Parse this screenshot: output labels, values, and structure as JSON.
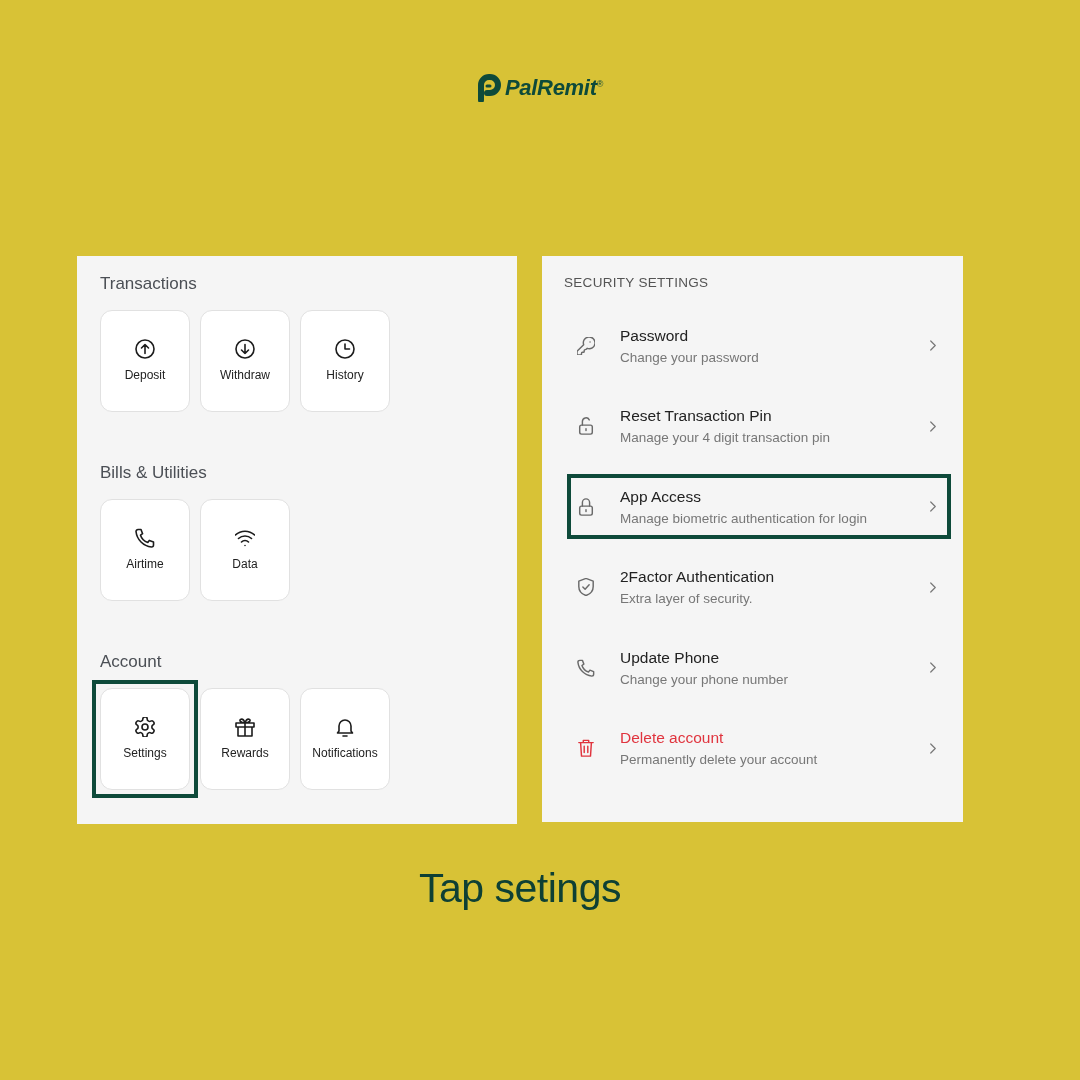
{
  "brand": {
    "name": "PalRemit$^{®}$"
  },
  "menu": {
    "sections": [
      {
        "heading": "Transactions",
        "tiles": [
          {
            "label": "Deposit",
            "highlighted": false
          },
          {
            "label": "Withdraw",
            "highlighted": false
          },
          {
            "label": "History",
            "highlighted": false
          }
        ]
      },
      {
        "heading": "Bills & Utilities",
        "tiles": [
          {
            "label": "Airtime",
            "highlighted": false
          },
          {
            "label": "Data",
            "highlighted": false
          }
        ]
      },
      {
        "heading": "Account",
        "tiles": [
          {
            "label": "Settings",
            "highlighted": true
          },
          {
            "label": "Rewards",
            "highlighted": false
          },
          {
            "label": "Notifications",
            "highlighted": false
          }
        ]
      }
    ]
  },
  "security": {
    "heading": "SECURITY SETTINGS",
    "items": [
      {
        "title": "Password",
        "subtitle": "Change your password",
        "highlighted": false,
        "destructive": false
      },
      {
        "title": "Reset Transaction Pin",
        "subtitle": "Manage your 4 digit transaction pin",
        "highlighted": false,
        "destructive": false
      },
      {
        "title": "App Access",
        "subtitle": "Manage biometric authentication for login",
        "highlighted": true,
        "destructive": false
      },
      {
        "title": "2Factor Authentication",
        "subtitle": "Extra layer of security.",
        "highlighted": false,
        "destructive": false
      },
      {
        "title": "Update Phone",
        "subtitle": "Change your phone number",
        "highlighted": false,
        "destructive": false
      },
      {
        "title": "Delete account",
        "subtitle": "Permanently delete your account",
        "highlighted": false,
        "destructive": true
      }
    ]
  },
  "caption": "Tap setings"
}
